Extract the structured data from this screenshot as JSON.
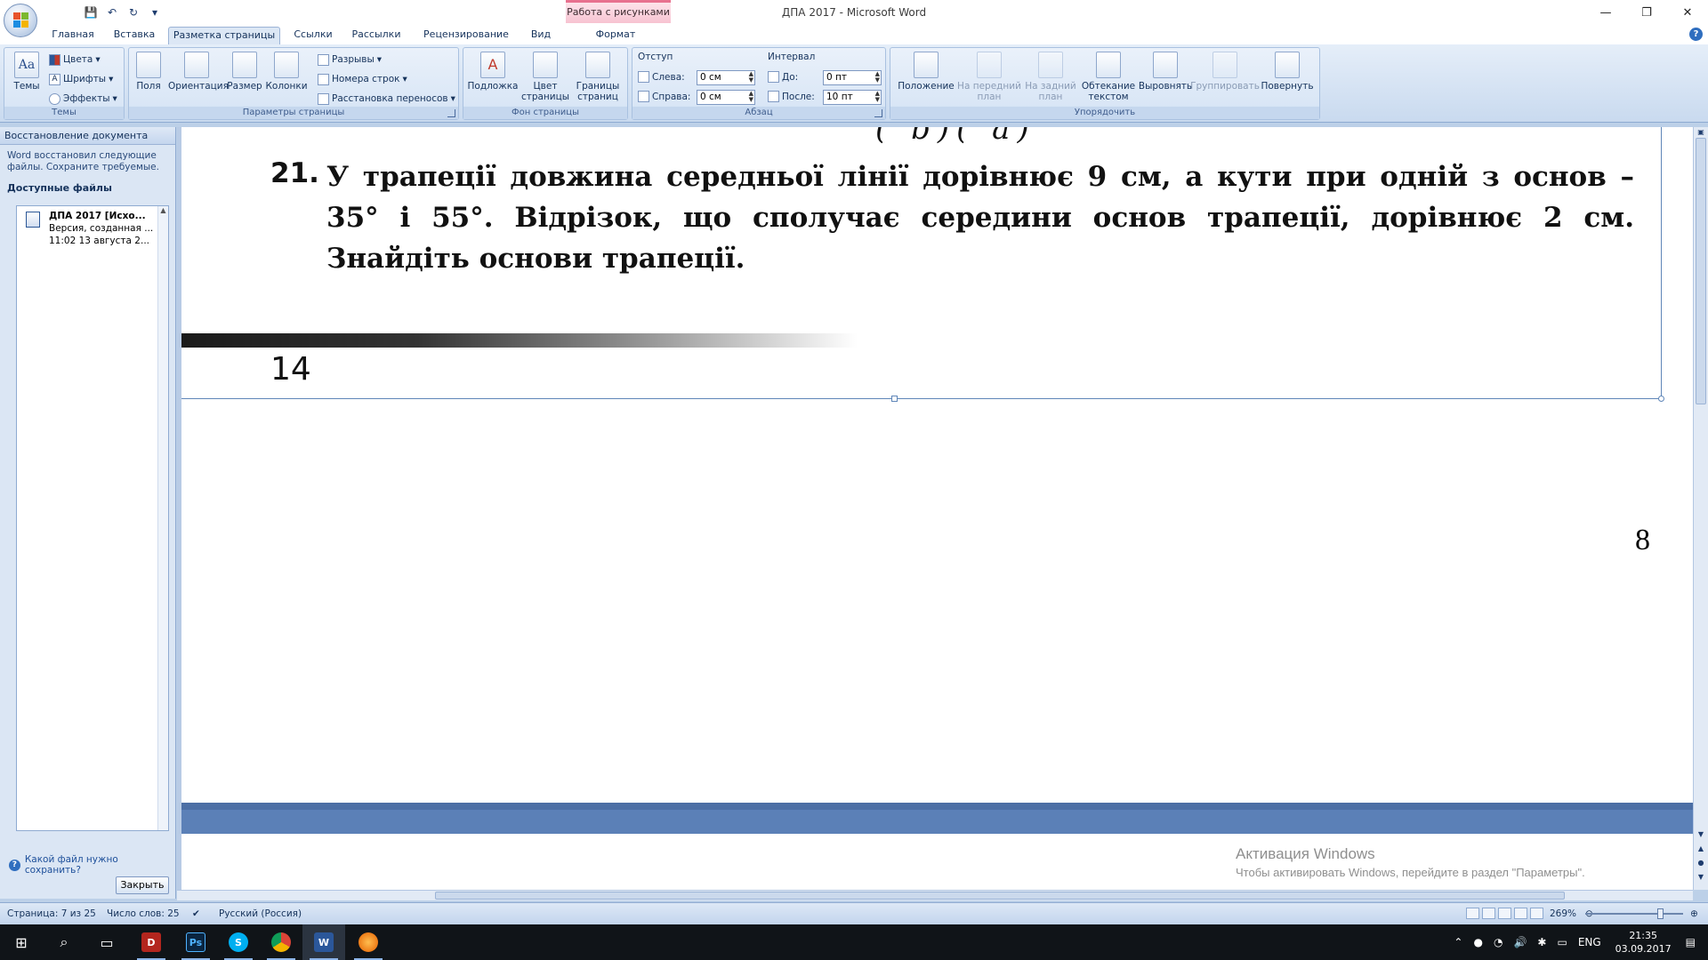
{
  "window": {
    "title": "ДПА 2017 - Microsoft Word",
    "context_tab_header": "Работа с рисунками",
    "controls": {
      "minimize": "—",
      "restore": "❐",
      "close": "✕"
    }
  },
  "qat": {
    "save": "💾",
    "undo": "↶",
    "redo": "↻",
    "more": "▾"
  },
  "tabs": [
    {
      "label": "Главная"
    },
    {
      "label": "Вставка"
    },
    {
      "label": "Разметка страницы"
    },
    {
      "label": "Ссылки"
    },
    {
      "label": "Рассылки"
    },
    {
      "label": "Рецензирование"
    },
    {
      "label": "Вид"
    },
    {
      "label": "Формат"
    }
  ],
  "ribbon": {
    "themes": {
      "label": "Темы",
      "themes_btn": "Темы",
      "colors": "Цвета",
      "fonts": "Шрифты",
      "effects": "Эффекты"
    },
    "page_setup": {
      "label": "Параметры страницы",
      "margins": "Поля",
      "orientation": "Ориентация",
      "size": "Размер",
      "columns": "Колонки",
      "breaks": "Разрывы",
      "line_numbers": "Номера строк",
      "hyphenation": "Расстановка переносов"
    },
    "page_background": {
      "label": "Фон страницы",
      "watermark": "Подложка",
      "page_color_1": "Цвет",
      "page_color_2": "страницы",
      "page_borders_1": "Границы",
      "page_borders_2": "страниц"
    },
    "paragraph": {
      "label": "Абзац",
      "indent_title": "Отступ",
      "left_label": "Слева:",
      "left_value": "0 см",
      "right_label": "Справа:",
      "right_value": "0 см",
      "spacing_title": "Интервал",
      "before_label": "До:",
      "before_value": "0 пт",
      "after_label": "После:",
      "after_value": "10 пт"
    },
    "arrange": {
      "label": "Упорядочить",
      "position": "Положение",
      "bring_forward_1": "На передний",
      "bring_forward_2": "план",
      "send_backward_1": "На задний",
      "send_backward_2": "план",
      "wrap_1": "Обтекание",
      "wrap_2": "текстом",
      "align": "Выровнять",
      "group": "Группировать",
      "rotate": "Повернуть"
    }
  },
  "recovery_pane": {
    "title": "Восстановление документа",
    "message": "Word восстановил следующие файлы.  Сохраните требуемые.",
    "available_files": "Доступные файлы",
    "file_name": "ДПА 2017  [Исхо...",
    "file_desc": "Версия, созданная ...",
    "file_time": "11:02 13 августа 2...",
    "question": "Какой файл нужно сохранить?",
    "close_button": "Закрыть"
  },
  "document": {
    "ghost_math": "(   b)(   a)",
    "problem_number": "21.",
    "problem_text": "У трапеції довжина середньої лінії дорівнює 9 см, а кути при одній з основ – 35° і 55°. Відрізок, що сполучає середини основ трапеції, дорівнює 2 см. Знайдіть основи трапеції.",
    "image_page_number": "14",
    "page_number": "8"
  },
  "activation": {
    "title": "Активация Windows",
    "subtitle": "Чтобы активировать Windows, перейдите в раздел \"Параметры\"."
  },
  "statusbar": {
    "page": "Страница: 7 из 25",
    "words": "Число слов: 25",
    "language": "Русский (Россия)",
    "zoom": "269%"
  },
  "taskbar": {
    "tray_lang": "ENG",
    "time": "21:35",
    "date": "03.09.2017"
  },
  "colors": {
    "ribbon_blue": "#c9daef",
    "context_pink": "#f7c3d1",
    "taskbar": "#101418"
  }
}
